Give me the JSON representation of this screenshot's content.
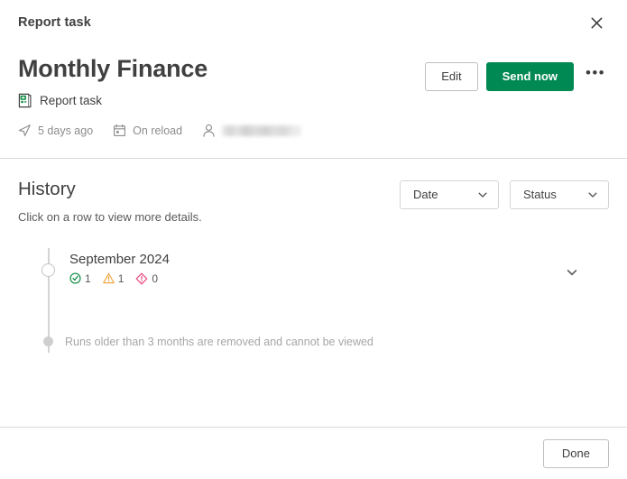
{
  "topbar": {
    "title": "Report task",
    "close_icon": "close-icon"
  },
  "header": {
    "page_title": "Monthly Finance",
    "subtitle": "Report task",
    "subtitle_icon": "report-task-icon",
    "meta": [
      {
        "icon": "send-icon",
        "label": "5 days ago"
      },
      {
        "icon": "calendar-icon",
        "label": "On reload"
      },
      {
        "icon": "user-icon",
        "label": ""
      }
    ],
    "actions": {
      "edit_label": "Edit",
      "send_now_label": "Send now",
      "more_icon": "ellipsis-icon",
      "more_label": "•••"
    }
  },
  "history": {
    "title": "History",
    "subtitle": "Click on a row to view more details.",
    "filters": [
      {
        "label": "Date",
        "icon": "chevron-down-icon"
      },
      {
        "label": "Status",
        "icon": "chevron-down-icon"
      }
    ],
    "rows": [
      {
        "date": "September 2024",
        "stats": [
          {
            "icon": "check-circle-icon",
            "value": "1",
            "color": "#00873c"
          },
          {
            "icon": "warning-triangle-icon",
            "value": "1",
            "color": "#f5a623"
          },
          {
            "icon": "error-diamond-icon",
            "value": "0",
            "color": "#e8467c"
          }
        ],
        "expand_icon": "chevron-down-icon"
      }
    ],
    "note": "Runs older than 3 months are removed and cannot be viewed"
  },
  "footer": {
    "done_label": "Done"
  },
  "colors": {
    "primary_green": "#008952",
    "text": "#404040",
    "muted": "#8c8c8c",
    "border": "#d9d9d9",
    "success": "#00873c",
    "warning": "#f5a623",
    "error": "#e8467c"
  }
}
